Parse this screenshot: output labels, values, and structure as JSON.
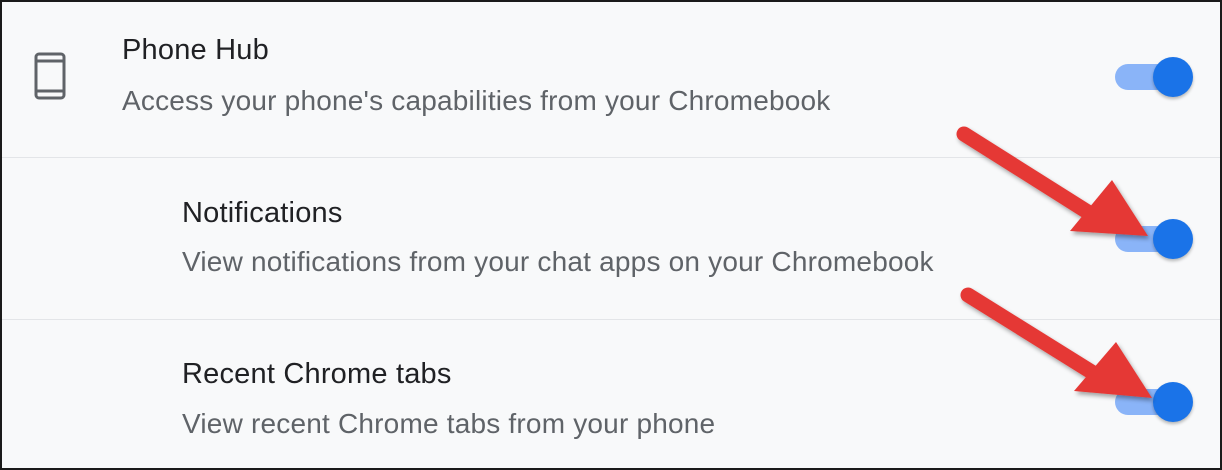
{
  "settings": {
    "phone_hub": {
      "icon": "smartphone-icon",
      "title": "Phone Hub",
      "description": "Access your phone's capabilities from your Chromebook",
      "enabled": true
    },
    "notifications": {
      "title": "Notifications",
      "description": "View notifications from your chat apps on your Chromebook",
      "enabled": true
    },
    "recent_tabs": {
      "title": "Recent Chrome tabs",
      "description": "View recent Chrome tabs from your phone",
      "enabled": true
    }
  },
  "colors": {
    "toggle_on_knob": "#1a73e8",
    "toggle_on_track": "#8ab4f8",
    "annotation_arrow": "#e53935",
    "title_text": "#202124",
    "description_text": "#5f6368"
  }
}
